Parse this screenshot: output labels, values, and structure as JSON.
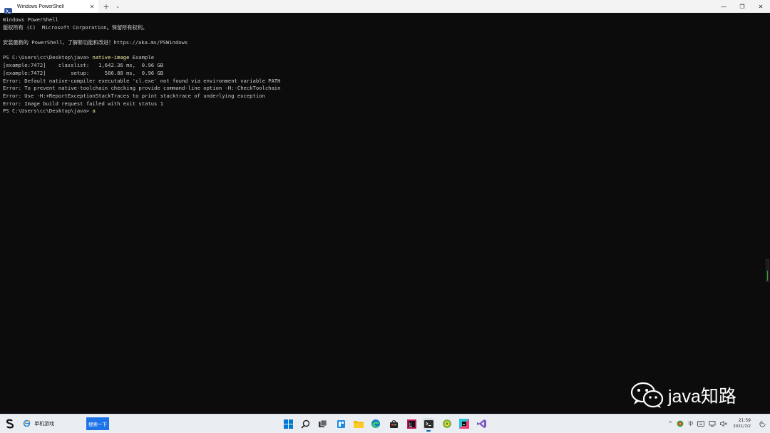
{
  "window": {
    "tab_title": "Windows PowerShell",
    "tab_close": "✕",
    "new_tab": "+",
    "tab_dropdown": "⌄",
    "minimize": "—",
    "maximize": "❐",
    "close": "✕"
  },
  "terminal": {
    "lines": [
      {
        "text": "Windows PowerShell"
      },
      {
        "text": "版权所有 (C)  Microsoft Corporation。保留所有权利。"
      },
      {
        "text": ""
      },
      {
        "text": "安装最新的 PowerShell，了解新功能和改进！https://aka.ms/PSWindows"
      },
      {
        "text": ""
      },
      {
        "prompt": "PS C:\\Users\\cc\\Desktop\\java> ",
        "command": "native-image",
        "args": " Example"
      },
      {
        "text": "[example:7472]    classlist:   1,642.36 ms,  0.96 GB"
      },
      {
        "text": "[example:7472]        setup:     586.88 ms,  0.96 GB"
      },
      {
        "text": "Error: Default native-compiler executable 'cl.exe' not found via environment variable PATH"
      },
      {
        "text": "Error: To prevent native-toolchain checking provide command-line option -H:-CheckToolchain"
      },
      {
        "text": "Error: Use -H:+ReportExceptionStackTraces to print stacktrace of underlying exception"
      },
      {
        "text": "Error: Image build request failed with exit status 1"
      },
      {
        "prompt": "PS C:\\Users\\cc\\Desktop\\java> ",
        "command": "a",
        "args": ""
      }
    ],
    "colors": {
      "background": "#0c0c0c",
      "text": "#cccccc",
      "command": "#f9f1a5"
    }
  },
  "watermark": {
    "text": "java知路"
  },
  "taskbar": {
    "game_label": "单机游戏",
    "search_button": "搜索一下",
    "icons": [
      "windows-start-icon",
      "search-icon",
      "task-view-icon",
      "widgets-icon",
      "file-explorer-icon",
      "edge-icon",
      "store-icon",
      "intellij-icon",
      "terminal-icon",
      "app-green-icon",
      "app-colorful-icon",
      "visual-studio-icon"
    ],
    "tray": {
      "chevron": "^",
      "ime": "中",
      "clock_time": "21:59",
      "clock_date": "2021/7/2"
    }
  }
}
